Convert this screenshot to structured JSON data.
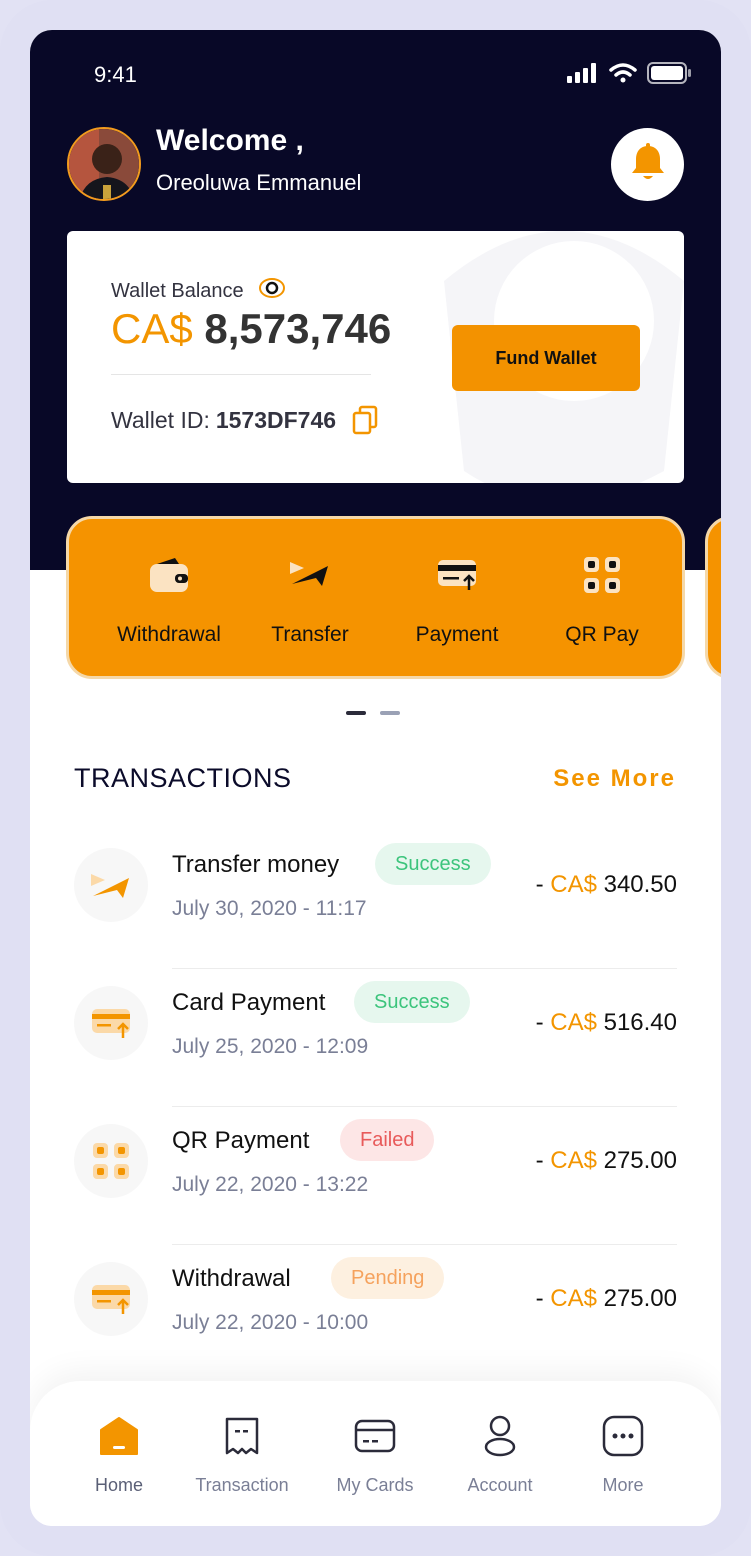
{
  "status_bar": {
    "time": "9:41"
  },
  "header": {
    "welcome": "Welcome ,",
    "username": "Oreoluwa Emmanuel"
  },
  "wallet": {
    "label": "Wallet Balance",
    "currency": "CA$",
    "amount": "8,573,746",
    "id_label": "Wallet ID:",
    "id_value": "1573DF746",
    "fund_button": "Fund Wallet"
  },
  "actions": [
    {
      "label": "Withdrawal",
      "icon": "wallet-icon"
    },
    {
      "label": "Transfer",
      "icon": "send-icon"
    },
    {
      "label": "Payment",
      "icon": "card-payment-icon"
    },
    {
      "label": "QR Pay",
      "icon": "qr-icon"
    }
  ],
  "pager": {
    "pages": 2,
    "active": 0
  },
  "transactions": {
    "title": "TRANSACTIONS",
    "see_more": "See More",
    "items": [
      {
        "title": "Transfer money",
        "status": "Success",
        "date": "July 30, 2020 - 11:17",
        "sign": "- ",
        "currency": "CA$",
        "amount": "340.50",
        "icon": "send-icon"
      },
      {
        "title": "Card Payment",
        "status": "Success",
        "date": "July 25, 2020 - 12:09",
        "sign": "- ",
        "currency": "CA$",
        "amount": "516.40",
        "icon": "card-payment-icon"
      },
      {
        "title": "QR Payment",
        "status": "Failed",
        "date": "July 22, 2020 - 13:22",
        "sign": "- ",
        "currency": "CA$",
        "amount": "275.00",
        "icon": "qr-icon"
      },
      {
        "title": "Withdrawal",
        "status": "Pending",
        "date": "July 22, 2020 - 10:00",
        "sign": "- ",
        "currency": "CA$",
        "amount": "275.00",
        "icon": "card-payment-icon"
      }
    ]
  },
  "bottom_nav": [
    {
      "label": "Home",
      "icon": "home-icon",
      "active": true
    },
    {
      "label": "Transaction",
      "icon": "receipt-icon",
      "active": false
    },
    {
      "label": "My Cards",
      "icon": "card-icon",
      "active": false
    },
    {
      "label": "Account",
      "icon": "user-icon",
      "active": false
    },
    {
      "label": "More",
      "icon": "more-icon",
      "active": false
    }
  ],
  "colors": {
    "accent": "#f39500",
    "header_bg": "#080827",
    "success_bg": "#e6f7ee",
    "success_text": "#3cc47c",
    "failed_bg": "#fde6e6",
    "failed_text": "#e85a5a",
    "pending_bg": "#fdf0e0",
    "pending_text": "#f5a25d"
  }
}
